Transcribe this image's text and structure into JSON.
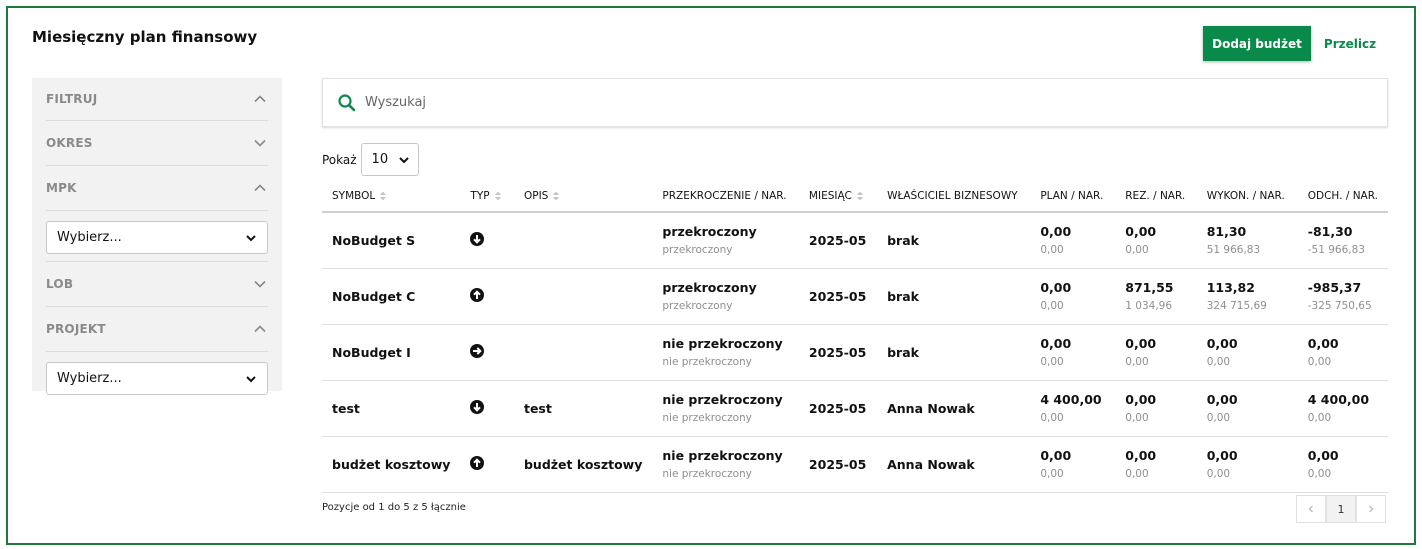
{
  "header": {
    "title": "Miesięczny plan finansowy",
    "add_budget_label": "Dodaj budżet",
    "recalc_label": "Przelicz"
  },
  "colors": {
    "accent": "#0a8a4a",
    "frame": "#1f7a3a"
  },
  "sidebar": {
    "filter_label": "FILTRUJ",
    "groups": [
      {
        "label": "OKRES",
        "expanded": false
      },
      {
        "label": "MPK",
        "expanded": true,
        "select_value": "Wybierz..."
      },
      {
        "label": "LOB",
        "expanded": false
      },
      {
        "label": "PROJEKT",
        "expanded": true,
        "select_value": "Wybierz..."
      }
    ]
  },
  "search": {
    "placeholder": "Wyszukaj",
    "icon": "search-icon"
  },
  "show": {
    "label": "Pokaż",
    "value": "10"
  },
  "table": {
    "columns": [
      "SYMBOL",
      "TYP",
      "OPIS",
      "PRZEKROCZENIE / NAR.",
      "MIESIĄC",
      "WŁAŚCICIEL BIZNESOWY",
      "PLAN / NAR.",
      "REZ. / NAR.",
      "WYKON. / NAR.",
      "ODCH. / NAR."
    ],
    "rows": [
      {
        "symbol": "NoBudget S",
        "type_icon": "arrow-down-circle-icon",
        "opis": "",
        "przekr": "przekroczony",
        "przekr_nar": "przekroczony",
        "miesiac": "2025-05",
        "wlasciciel": "brak",
        "plan": "0,00",
        "plan_nar": "0,00",
        "rez": "0,00",
        "rez_nar": "0,00",
        "wykon": "81,30",
        "wykon_nar": "51 966,83",
        "odch": "-81,30",
        "odch_nar": "-51 966,83"
      },
      {
        "symbol": "NoBudget C",
        "type_icon": "arrow-up-circle-icon",
        "opis": "",
        "przekr": "przekroczony",
        "przekr_nar": "przekroczony",
        "miesiac": "2025-05",
        "wlasciciel": "brak",
        "plan": "0,00",
        "plan_nar": "0,00",
        "rez": "871,55",
        "rez_nar": "1 034,96",
        "wykon": "113,82",
        "wykon_nar": "324 715,69",
        "odch": "-985,37",
        "odch_nar": "-325 750,65"
      },
      {
        "symbol": "NoBudget I",
        "type_icon": "arrow-right-circle-icon",
        "opis": "",
        "przekr": "nie przekroczony",
        "przekr_nar": "nie przekroczony",
        "miesiac": "2025-05",
        "wlasciciel": "brak",
        "plan": "0,00",
        "plan_nar": "0,00",
        "rez": "0,00",
        "rez_nar": "0,00",
        "wykon": "0,00",
        "wykon_nar": "0,00",
        "odch": "0,00",
        "odch_nar": "0,00"
      },
      {
        "symbol": "test",
        "type_icon": "arrow-down-circle-icon",
        "opis": "test",
        "przekr": "nie przekroczony",
        "przekr_nar": "nie przekroczony",
        "miesiac": "2025-05",
        "wlasciciel": "Anna Nowak",
        "plan": "4 400,00",
        "plan_nar": "0,00",
        "rez": "0,00",
        "rez_nar": "0,00",
        "wykon": "0,00",
        "wykon_nar": "0,00",
        "odch": "4 400,00",
        "odch_nar": "0,00"
      },
      {
        "symbol": "budżet kosztowy",
        "type_icon": "arrow-up-circle-icon",
        "opis": "budżet kosztowy",
        "przekr": "nie przekroczony",
        "przekr_nar": "nie przekroczony",
        "miesiac": "2025-05",
        "wlasciciel": "Anna Nowak",
        "plan": "0,00",
        "plan_nar": "0,00",
        "rez": "0,00",
        "rez_nar": "0,00",
        "wykon": "0,00",
        "wykon_nar": "0,00",
        "odch": "0,00",
        "odch_nar": "0,00"
      }
    ]
  },
  "footer": {
    "info": "Pozycje od 1 do 5 z 5 łącznie",
    "current_page": "1"
  }
}
